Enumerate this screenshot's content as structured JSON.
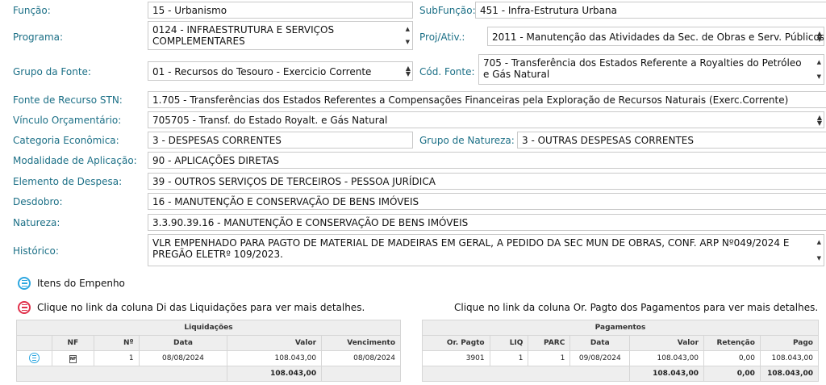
{
  "fields": {
    "funcao": {
      "label": "Função:",
      "value": "15 - Urbanismo"
    },
    "subfuncao": {
      "label": "SubFunção:",
      "value": "451 - Infra-Estrutura Urbana"
    },
    "programa": {
      "label": "Programa:",
      "value": "0124 - INFRAESTRUTURA E SERVIÇOS COMPLEMENTARES"
    },
    "projativ": {
      "label": "Proj/Ativ.:",
      "value": "2011 - Manutenção das Atividades da Sec. de Obras e Serv. Públicos"
    },
    "grupo_fonte": {
      "label": "Grupo da Fonte:",
      "value": "01 - Recursos do Tesouro - Exercicio Corrente"
    },
    "cod_fonte": {
      "label": "Cód. Fonte:",
      "value": "705 - Transferência dos Estados Referente a Royalties do Petróleo e Gás Natural"
    },
    "fonte_stn": {
      "label": "Fonte de Recurso STN:",
      "value": "1.705 - Transferências dos Estados Referentes a Compensações Financeiras pela Exploração de Recursos Naturais (Exerc.Corrente)"
    },
    "vinculo": {
      "label": "Vínculo Orçamentário:",
      "value": "705705 - Transf. do Estado Royalt. e Gás Natural"
    },
    "categoria": {
      "label": "Categoria Econômica:",
      "value": "3 - DESPESAS CORRENTES"
    },
    "grupo_natureza": {
      "label": "Grupo de Natureza:",
      "value": "3 - OUTRAS DESPESAS CORRENTES"
    },
    "modalidade": {
      "label": "Modalidade de Aplicação:",
      "value": "90 - APLICAÇÕES DIRETAS"
    },
    "elemento": {
      "label": "Elemento de Despesa:",
      "value": "39 - OUTROS SERVIÇOS DE TERCEIROS - PESSOA JURÍDICA"
    },
    "desdobro": {
      "label": "Desdobro:",
      "value": "16 - MANUTENÇÃO E CONSERVAÇÃO DE BENS IMÓVEIS"
    },
    "natureza": {
      "label": "Natureza:",
      "value": "3.3.90.39.16 - MANUTENÇÃO E CONSERVAÇÃO DE BENS IMÓVEIS"
    },
    "historico": {
      "label": "Histórico:",
      "value": "VLR EMPENHADO PARA PAGTO DE MATERIAL DE MADEIRAS EM GERAL, A PEDIDO DA SEC MUN DE OBRAS, CONF. ARP Nº049/2024 E PREGÃO ELETRº 109/2023."
    }
  },
  "sections": {
    "itens": "Itens do Empenho",
    "liq_hint": "Clique no link da coluna Di das Liquidações para ver mais detalhes.",
    "pag_hint": "Clique no link da coluna Or. Pagto dos Pagamentos para ver mais detalhes."
  },
  "icons": {
    "list": "list-icon",
    "nf": "nf-document-icon"
  },
  "liquidacoes": {
    "title": "Liquidações",
    "headers": {
      "nf": "NF",
      "num": "Nº",
      "data": "Data",
      "valor": "Valor",
      "venc": "Vencimento"
    },
    "rows": [
      {
        "nf_glyph": "NF",
        "num": "1",
        "data": "08/08/2024",
        "valor": "108.043,00",
        "venc": "08/08/2024"
      }
    ],
    "total": "108.043,00"
  },
  "pagamentos": {
    "title": "Pagamentos",
    "headers": {
      "orpagto": "Or. Pagto",
      "liq": "LIQ",
      "parc": "PARC",
      "data": "Data",
      "valor": "Valor",
      "retencao": "Retenção",
      "pago": "Pago"
    },
    "rows": [
      {
        "orpagto": "3901",
        "liq": "1",
        "parc": "1",
        "data": "09/08/2024",
        "valor": "108.043,00",
        "retencao": "0,00",
        "pago": "108.043,00"
      }
    ],
    "totals": {
      "valor": "108.043,00",
      "retencao": "0,00",
      "pago": "108.043,00"
    }
  },
  "colors": {
    "label": "#1b6f86",
    "icon_blue": "#2ea7e0",
    "icon_red": "#e0304a"
  }
}
